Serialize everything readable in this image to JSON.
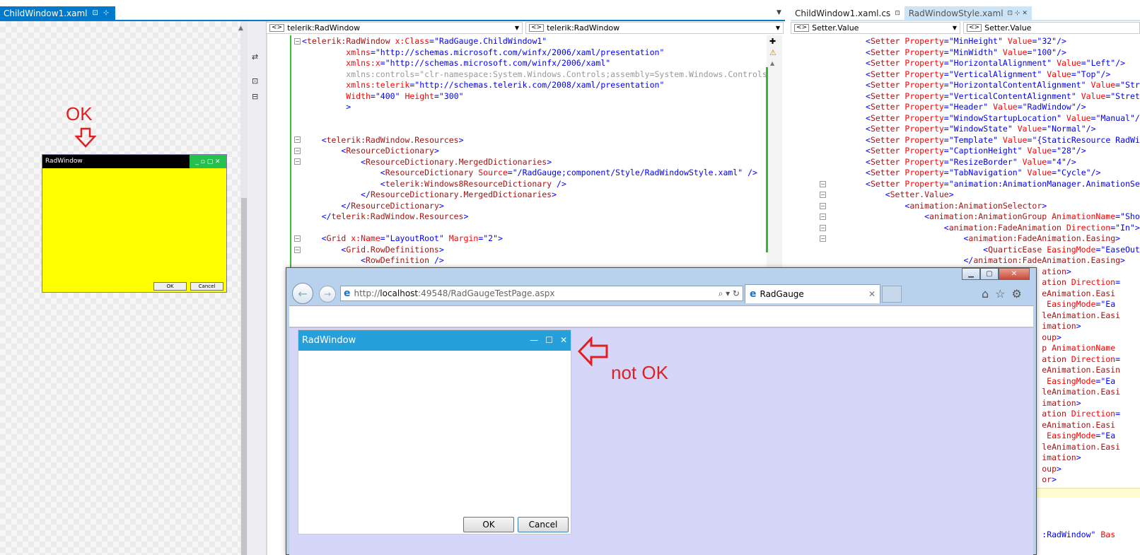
{
  "tabs": {
    "left": {
      "label": "ChildWindow1.xaml",
      "pin": "⊡",
      "dock": "⊹",
      "close": "✕"
    },
    "right": [
      {
        "label": "ChildWindow1.xaml.cs",
        "glyph": "⊡"
      },
      {
        "label": "RadWindowStyle.xaml",
        "glyph": "⊡ ⊹ ✕"
      }
    ]
  },
  "nav": {
    "left_type": "telerik:RadWindow",
    "left_member": "telerik:RadWindow",
    "right_type": "Setter.Value",
    "right_member": "Setter.Value"
  },
  "designer": {
    "annotation": "OK",
    "window_title": "RadWindow",
    "ok_button": "OK",
    "cancel_button": "Cancel",
    "ctrl_glyphs": "_ ▫ ▢ ✕"
  },
  "code_left": [
    [
      [
        "br",
        "<"
      ],
      [
        "tg",
        "telerik:RadWindow"
      ],
      [
        "at",
        " x:Class"
      ],
      [
        "br",
        "=\""
      ],
      [
        "vl",
        "RadGauge.ChildWindow1"
      ],
      [
        "br",
        "\""
      ]
    ],
    [
      [
        "at",
        "         xmlns"
      ],
      [
        "br",
        "=\""
      ],
      [
        "vl",
        "http://schemas.microsoft.com/winfx/2006/xaml/presentation"
      ],
      [
        "br",
        "\""
      ]
    ],
    [
      [
        "at",
        "         xmlns:x"
      ],
      [
        "br",
        "=\""
      ],
      [
        "vl",
        "http://schemas.microsoft.com/winfx/2006/xaml"
      ],
      [
        "br",
        "\""
      ]
    ],
    [
      [
        "gr",
        "         xmlns:controls=\"clr-namespace:System.Windows.Controls;assembly=System.Windows.Controls\""
      ]
    ],
    [
      [
        "at",
        "         xmlns:telerik"
      ],
      [
        "br",
        "=\""
      ],
      [
        "vl",
        "http://schemas.telerik.com/2008/xaml/presentation"
      ],
      [
        "br",
        "\""
      ]
    ],
    [
      [
        "at",
        "         Width"
      ],
      [
        "br",
        "=\""
      ],
      [
        "vl",
        "400"
      ],
      [
        "br",
        "\""
      ],
      [
        "at",
        " Height"
      ],
      [
        "br",
        "=\""
      ],
      [
        "vl",
        "300"
      ],
      [
        "br",
        "\""
      ]
    ],
    [
      [
        "br",
        "         >"
      ]
    ],
    [
      [
        "br",
        ""
      ]
    ],
    [
      [
        "br",
        ""
      ]
    ],
    [
      [
        "br",
        "    <"
      ],
      [
        "tg",
        "telerik:RadWindow.Resources"
      ],
      [
        "br",
        ">"
      ]
    ],
    [
      [
        "br",
        "        <"
      ],
      [
        "tg",
        "ResourceDictionary"
      ],
      [
        "br",
        ">"
      ]
    ],
    [
      [
        "br",
        "            <"
      ],
      [
        "tg",
        "ResourceDictionary.MergedDictionaries"
      ],
      [
        "br",
        ">"
      ]
    ],
    [
      [
        "br",
        "                <"
      ],
      [
        "tg",
        "ResourceDictionary"
      ],
      [
        "at",
        " Source"
      ],
      [
        "br",
        "=\""
      ],
      [
        "vl",
        "/RadGauge;component/Style/RadWindowStyle.xaml"
      ],
      [
        "br",
        "\" />"
      ]
    ],
    [
      [
        "br",
        "                <"
      ],
      [
        "tg",
        "telerik:Windows8ResourceDictionary"
      ],
      [
        "br",
        " />"
      ]
    ],
    [
      [
        "br",
        "            </"
      ],
      [
        "tg",
        "ResourceDictionary.MergedDictionaries"
      ],
      [
        "br",
        ">"
      ]
    ],
    [
      [
        "br",
        "        </"
      ],
      [
        "tg",
        "ResourceDictionary"
      ],
      [
        "br",
        ">"
      ]
    ],
    [
      [
        "br",
        "    </"
      ],
      [
        "tg",
        "telerik:RadWindow.Resources"
      ],
      [
        "br",
        ">"
      ]
    ],
    [
      [
        "br",
        ""
      ]
    ],
    [
      [
        "br",
        "    <"
      ],
      [
        "tg",
        "Grid"
      ],
      [
        "at",
        " x:Name"
      ],
      [
        "br",
        "=\""
      ],
      [
        "vl",
        "LayoutRoot"
      ],
      [
        "br",
        "\""
      ],
      [
        "at",
        " Margin"
      ],
      [
        "br",
        "=\""
      ],
      [
        "vl",
        "2"
      ],
      [
        "br",
        "\">"
      ]
    ],
    [
      [
        "br",
        "        <"
      ],
      [
        "tg",
        "Grid.RowDefinitions"
      ],
      [
        "br",
        ">"
      ]
    ],
    [
      [
        "br",
        "            <"
      ],
      [
        "tg",
        "RowDefinition"
      ],
      [
        "br",
        " />"
      ]
    ]
  ],
  "code_right": [
    [
      [
        "br",
        "<"
      ],
      [
        "tg",
        "Setter"
      ],
      [
        "at",
        " Property"
      ],
      [
        "br",
        "=\""
      ],
      [
        "vl",
        "MinHeight"
      ],
      [
        "br",
        "\""
      ],
      [
        "at",
        " Value"
      ],
      [
        "br",
        "=\""
      ],
      [
        "vl",
        "32"
      ],
      [
        "br",
        "\"/>"
      ]
    ],
    [
      [
        "br",
        "<"
      ],
      [
        "tg",
        "Setter"
      ],
      [
        "at",
        " Property"
      ],
      [
        "br",
        "=\""
      ],
      [
        "vl",
        "MinWidth"
      ],
      [
        "br",
        "\""
      ],
      [
        "at",
        " Value"
      ],
      [
        "br",
        "=\""
      ],
      [
        "vl",
        "100"
      ],
      [
        "br",
        "\"/>"
      ]
    ],
    [
      [
        "br",
        "<"
      ],
      [
        "tg",
        "Setter"
      ],
      [
        "at",
        " Property"
      ],
      [
        "br",
        "=\""
      ],
      [
        "vl",
        "HorizontalAlignment"
      ],
      [
        "br",
        "\""
      ],
      [
        "at",
        " Value"
      ],
      [
        "br",
        "=\""
      ],
      [
        "vl",
        "Left"
      ],
      [
        "br",
        "\"/>"
      ]
    ],
    [
      [
        "br",
        "<"
      ],
      [
        "tg",
        "Setter"
      ],
      [
        "at",
        " Property"
      ],
      [
        "br",
        "=\""
      ],
      [
        "vl",
        "VerticalAlignment"
      ],
      [
        "br",
        "\""
      ],
      [
        "at",
        " Value"
      ],
      [
        "br",
        "=\""
      ],
      [
        "vl",
        "Top"
      ],
      [
        "br",
        "\"/>"
      ]
    ],
    [
      [
        "br",
        "<"
      ],
      [
        "tg",
        "Setter"
      ],
      [
        "at",
        " Property"
      ],
      [
        "br",
        "=\""
      ],
      [
        "vl",
        "HorizontalContentAlignment"
      ],
      [
        "br",
        "\""
      ],
      [
        "at",
        " Value"
      ],
      [
        "br",
        "=\""
      ],
      [
        "vl",
        "Stretch"
      ],
      [
        "br",
        "\"/>"
      ]
    ],
    [
      [
        "br",
        "<"
      ],
      [
        "tg",
        "Setter"
      ],
      [
        "at",
        " Property"
      ],
      [
        "br",
        "=\""
      ],
      [
        "vl",
        "VerticalContentAlignment"
      ],
      [
        "br",
        "\""
      ],
      [
        "at",
        " Value"
      ],
      [
        "br",
        "=\""
      ],
      [
        "vl",
        "Stretch"
      ],
      [
        "br",
        "\"/>"
      ]
    ],
    [
      [
        "br",
        "<"
      ],
      [
        "tg",
        "Setter"
      ],
      [
        "at",
        " Property"
      ],
      [
        "br",
        "=\""
      ],
      [
        "vl",
        "Header"
      ],
      [
        "br",
        "\""
      ],
      [
        "at",
        " Value"
      ],
      [
        "br",
        "=\""
      ],
      [
        "vl",
        "RadWindow"
      ],
      [
        "br",
        "\"/>"
      ]
    ],
    [
      [
        "br",
        "<"
      ],
      [
        "tg",
        "Setter"
      ],
      [
        "at",
        " Property"
      ],
      [
        "br",
        "=\""
      ],
      [
        "vl",
        "WindowStartupLocation"
      ],
      [
        "br",
        "\""
      ],
      [
        "at",
        " Value"
      ],
      [
        "br",
        "=\""
      ],
      [
        "vl",
        "Manual"
      ],
      [
        "br",
        "\"/>"
      ]
    ],
    [
      [
        "br",
        "<"
      ],
      [
        "tg",
        "Setter"
      ],
      [
        "at",
        " Property"
      ],
      [
        "br",
        "=\""
      ],
      [
        "vl",
        "WindowState"
      ],
      [
        "br",
        "\""
      ],
      [
        "at",
        " Value"
      ],
      [
        "br",
        "=\""
      ],
      [
        "vl",
        "Normal"
      ],
      [
        "br",
        "\"/>"
      ]
    ],
    [
      [
        "br",
        "<"
      ],
      [
        "tg",
        "Setter"
      ],
      [
        "at",
        " Property"
      ],
      [
        "br",
        "=\""
      ],
      [
        "vl",
        "Template"
      ],
      [
        "br",
        "\""
      ],
      [
        "at",
        " Value"
      ],
      [
        "br",
        "=\""
      ],
      [
        "vl",
        "{StaticResource RadWindowTemplate}"
      ],
      [
        "br",
        "\"/>"
      ]
    ],
    [
      [
        "br",
        "<"
      ],
      [
        "tg",
        "Setter"
      ],
      [
        "at",
        " Property"
      ],
      [
        "br",
        "=\""
      ],
      [
        "vl",
        "CaptionHeight"
      ],
      [
        "br",
        "\""
      ],
      [
        "at",
        " Value"
      ],
      [
        "br",
        "=\""
      ],
      [
        "vl",
        "28"
      ],
      [
        "br",
        "\"/>"
      ]
    ],
    [
      [
        "br",
        "<"
      ],
      [
        "tg",
        "Setter"
      ],
      [
        "at",
        " Property"
      ],
      [
        "br",
        "=\""
      ],
      [
        "vl",
        "ResizeBorder"
      ],
      [
        "br",
        "\""
      ],
      [
        "at",
        " Value"
      ],
      [
        "br",
        "=\""
      ],
      [
        "vl",
        "4"
      ],
      [
        "br",
        "\"/>"
      ]
    ],
    [
      [
        "br",
        "<"
      ],
      [
        "tg",
        "Setter"
      ],
      [
        "at",
        " Property"
      ],
      [
        "br",
        "=\""
      ],
      [
        "vl",
        "TabNavigation"
      ],
      [
        "br",
        "\""
      ],
      [
        "at",
        " Value"
      ],
      [
        "br",
        "=\""
      ],
      [
        "vl",
        "Cycle"
      ],
      [
        "br",
        "\"/>"
      ]
    ],
    [
      [
        "br",
        "<"
      ],
      [
        "tg",
        "Setter"
      ],
      [
        "at",
        " Property"
      ],
      [
        "br",
        "=\""
      ],
      [
        "vl",
        "animation:AnimationManager.AnimationSelector"
      ],
      [
        "br",
        "\">"
      ]
    ],
    [
      [
        "br",
        "    <"
      ],
      [
        "tg",
        "Setter.Value"
      ],
      [
        "br",
        ">"
      ]
    ],
    [
      [
        "br",
        "        <"
      ],
      [
        "tg",
        "animation:AnimationSelector"
      ],
      [
        "br",
        ">"
      ]
    ],
    [
      [
        "br",
        "            <"
      ],
      [
        "tg",
        "animation:AnimationGroup"
      ],
      [
        "at",
        " AnimationName"
      ],
      [
        "br",
        "=\""
      ],
      [
        "vl",
        "Show"
      ],
      [
        "br",
        "\">"
      ]
    ],
    [
      [
        "br",
        "                <"
      ],
      [
        "tg",
        "animation:FadeAnimation"
      ],
      [
        "at",
        " Direction"
      ],
      [
        "br",
        "=\""
      ],
      [
        "vl",
        "In"
      ],
      [
        "br",
        "\">"
      ]
    ],
    [
      [
        "br",
        "                    <"
      ],
      [
        "tg",
        "animation:FadeAnimation.Easing"
      ],
      [
        "br",
        ">"
      ]
    ],
    [
      [
        "br",
        "                        <"
      ],
      [
        "tg",
        "QuarticEase"
      ],
      [
        "at",
        " EasingMode"
      ],
      [
        "br",
        "=\""
      ],
      [
        "vl",
        "EaseOut"
      ],
      [
        "br",
        "\"/>"
      ]
    ],
    [
      [
        "br",
        "                    </"
      ],
      [
        "tg",
        "animation:FadeAnimation.Easing"
      ],
      [
        "br",
        ">"
      ]
    ],
    [
      [
        "br",
        "                                    "
      ],
      [
        "tg",
        "ation"
      ],
      [
        "br",
        ">"
      ]
    ],
    [
      [
        "br",
        "                                    "
      ],
      [
        "tg",
        "ation"
      ],
      [
        "at",
        " Direction"
      ],
      [
        "br",
        "="
      ]
    ],
    [
      [
        "br",
        "                                    "
      ],
      [
        "tg",
        "eAnimation.Easi"
      ]
    ],
    [
      [
        "br",
        "                                    "
      ],
      [
        "at",
        " EasingMode"
      ],
      [
        "br",
        "=\""
      ],
      [
        "vl",
        "Ea"
      ]
    ],
    [
      [
        "br",
        "                                    "
      ],
      [
        "tg",
        "leAnimation.Easi"
      ]
    ],
    [
      [
        "br",
        "                                    "
      ],
      [
        "tg",
        "imation"
      ],
      [
        "br",
        ">"
      ]
    ],
    [
      [
        "br",
        "                                    "
      ],
      [
        "tg",
        "oup"
      ],
      [
        "br",
        ">"
      ]
    ],
    [
      [
        "br",
        "                                    "
      ],
      [
        "tg",
        "p"
      ],
      [
        "at",
        " AnimationName"
      ]
    ],
    [
      [
        "br",
        "                                    "
      ],
      [
        "tg",
        "ation"
      ],
      [
        "at",
        " Direction"
      ],
      [
        "br",
        "="
      ]
    ],
    [
      [
        "br",
        "                                    "
      ],
      [
        "tg",
        "eAnimation.Easin"
      ]
    ],
    [
      [
        "br",
        "                                    "
      ],
      [
        "at",
        " EasingMode"
      ],
      [
        "br",
        "=\""
      ],
      [
        "vl",
        "Ea"
      ]
    ],
    [
      [
        "br",
        "                                    "
      ],
      [
        "tg",
        "leAnimation.Easi"
      ]
    ],
    [
      [
        "br",
        "                                    "
      ],
      [
        "tg",
        "imation"
      ],
      [
        "br",
        ">"
      ]
    ],
    [
      [
        "br",
        "                                    "
      ],
      [
        "tg",
        "ation"
      ],
      [
        "at",
        " Direction"
      ],
      [
        "br",
        "="
      ]
    ],
    [
      [
        "br",
        "                                    "
      ],
      [
        "tg",
        "eAnimation.Easi"
      ]
    ],
    [
      [
        "br",
        "                                    "
      ],
      [
        "at",
        " EasingMode"
      ],
      [
        "br",
        "=\""
      ],
      [
        "vl",
        "Ea"
      ]
    ],
    [
      [
        "br",
        "                                    "
      ],
      [
        "tg",
        "leAnimation.Easi"
      ]
    ],
    [
      [
        "br",
        "                                    "
      ],
      [
        "tg",
        "imation"
      ],
      [
        "br",
        ">"
      ]
    ],
    [
      [
        "br",
        "                                    "
      ],
      [
        "tg",
        "oup"
      ],
      [
        "br",
        ">"
      ]
    ],
    [
      [
        "br",
        "                                    "
      ],
      [
        "tg",
        "or"
      ],
      [
        "br",
        ">"
      ]
    ],
    [
      [
        "br",
        ""
      ]
    ],
    [
      [
        "br",
        ""
      ]
    ],
    [
      [
        "br",
        ""
      ]
    ],
    [
      [
        "br",
        ""
      ]
    ],
    [
      [
        "br",
        "                                    :"
      ],
      [
        "vl",
        "RadWindow"
      ],
      [
        "br",
        "\""
      ],
      [
        "at",
        " Bas"
      ]
    ]
  ],
  "browser": {
    "url_prefix": "http://",
    "url_host": "localhost",
    "url_rest": ":49548/RadGaugeTestPage.aspx",
    "addr_controls": "⌕ ▾ ↻",
    "tab_title": "RadGauge",
    "tab_close": "✕",
    "caption_min": "▁",
    "caption_max": "▢",
    "caption_close": "✕",
    "window_title": "RadWindow",
    "win_min": "—",
    "win_max": "☐",
    "win_close": "✕",
    "ok_button": "OK",
    "cancel_button": "Cancel",
    "annotation": "not OK"
  }
}
